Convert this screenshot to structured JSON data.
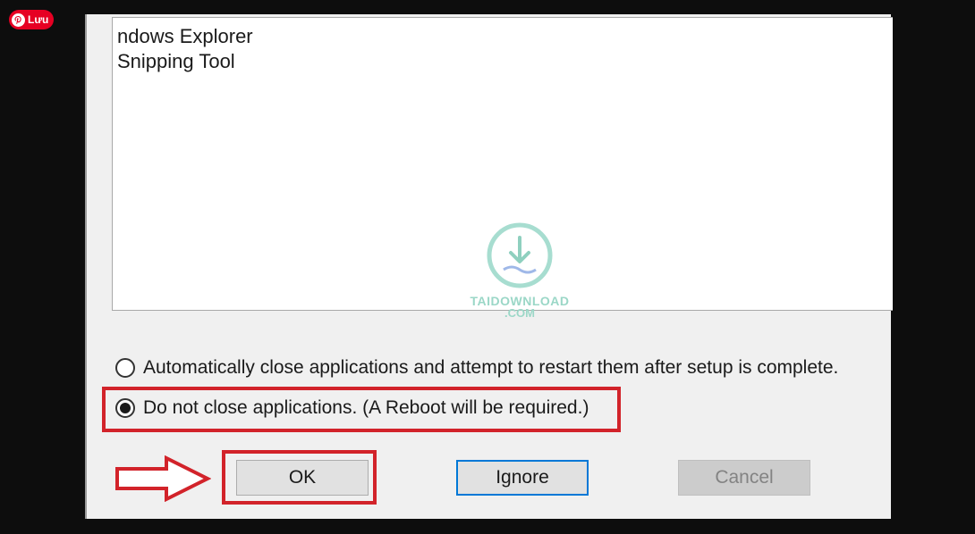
{
  "app_list": {
    "items": [
      "ndows Explorer",
      "Snipping Tool"
    ]
  },
  "pin_badge": {
    "label": "Lưu"
  },
  "watermark": {
    "line1": "TAIDOWNLOAD",
    "line2": ".COM"
  },
  "options": {
    "auto_close": "Automatically close applications and attempt to restart them after setup is complete.",
    "do_not_close": "Do not close applications. (A Reboot will be required.)",
    "selected": "do_not_close"
  },
  "buttons": {
    "ok": "OK",
    "ignore": "Ignore",
    "cancel": "Cancel"
  },
  "colors": {
    "highlight": "#d2232a",
    "focus": "#0078d7",
    "pin_red": "#e60023"
  }
}
